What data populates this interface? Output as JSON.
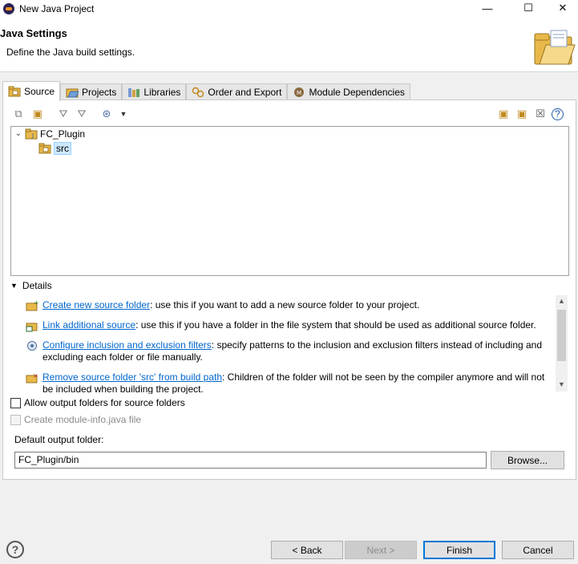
{
  "window": {
    "title": "New Java Project",
    "minimize": "—",
    "maximize": "☐",
    "close": "✕"
  },
  "header": {
    "title": "Java Settings",
    "description": "Define the Java build settings."
  },
  "tabs": [
    {
      "label": "Source"
    },
    {
      "label": "Projects"
    },
    {
      "label": "Libraries"
    },
    {
      "label": "Order and Export"
    },
    {
      "label": "Module Dependencies"
    }
  ],
  "tree": {
    "project": "FC_Plugin",
    "folder": "src"
  },
  "details": {
    "header": "Details",
    "items": [
      {
        "link": "Create new source folder",
        "text": ": use this if you want to add a new source folder to your project."
      },
      {
        "link": "Link additional source",
        "text": ": use this if you have a folder in the file system that should be used as additional source folder."
      },
      {
        "link": "Configure inclusion and exclusion filters",
        "text": ": specify patterns to the inclusion and exclusion filters instead of including and excluding each folder or file manually."
      },
      {
        "link": "Remove source folder 'src' from build path",
        "text": ": Children of the folder will not be seen by the compiler anymore and will not be included when building the project."
      }
    ]
  },
  "options": {
    "allow_output_folders": "Allow output folders for source folders",
    "create_module_info": "Create module-info.java file"
  },
  "output": {
    "label": "Default output folder:",
    "value": "FC_Plugin/bin",
    "browse": "Browse..."
  },
  "buttons": {
    "back": "< Back",
    "next": "Next >",
    "finish": "Finish",
    "cancel": "Cancel",
    "help": "?"
  }
}
